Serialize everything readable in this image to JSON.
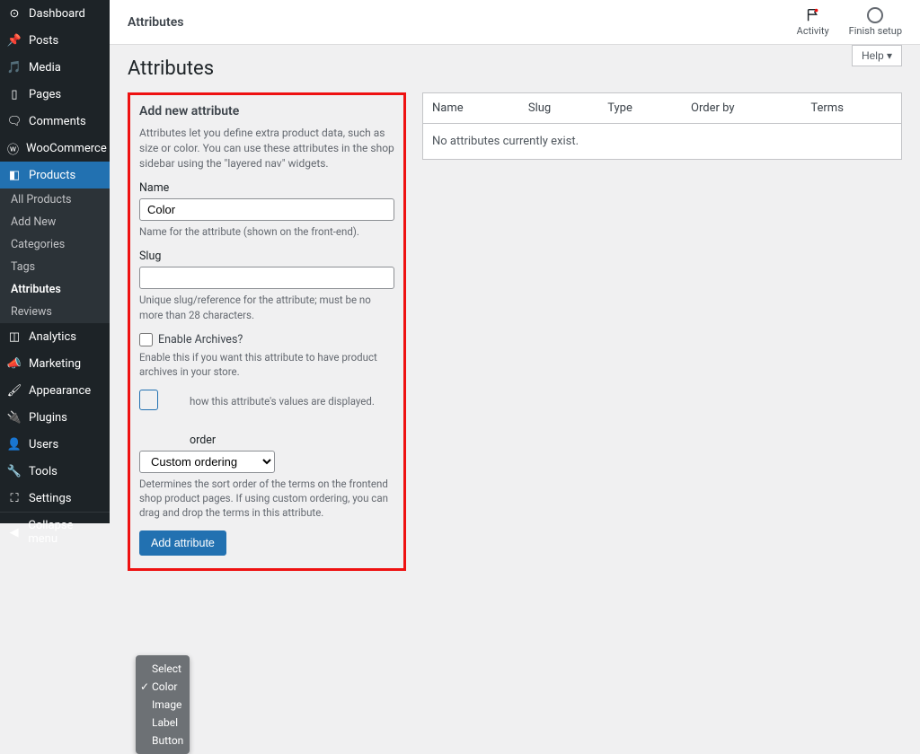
{
  "sidebar": {
    "items": [
      {
        "label": "Dashboard",
        "icon": "dashboard"
      },
      {
        "label": "Posts",
        "icon": "pin"
      },
      {
        "label": "Media",
        "icon": "media"
      },
      {
        "label": "Pages",
        "icon": "page"
      },
      {
        "label": "Comments",
        "icon": "comment"
      },
      {
        "label": "WooCommerce",
        "icon": "woo"
      },
      {
        "label": "Products",
        "icon": "products",
        "active": true
      },
      {
        "label": "Analytics",
        "icon": "analytics"
      },
      {
        "label": "Marketing",
        "icon": "marketing"
      },
      {
        "label": "Appearance",
        "icon": "appearance"
      },
      {
        "label": "Plugins",
        "icon": "plugins"
      },
      {
        "label": "Users",
        "icon": "users"
      },
      {
        "label": "Tools",
        "icon": "tools"
      },
      {
        "label": "Settings",
        "icon": "settings"
      }
    ],
    "products_submenu": [
      "All Products",
      "Add New",
      "Categories",
      "Tags",
      "Attributes",
      "Reviews"
    ],
    "collapse": "Collapse menu"
  },
  "topbar": {
    "title": "Attributes",
    "activity": "Activity",
    "finish": "Finish setup"
  },
  "page": {
    "heading": "Attributes",
    "help": "Help ▾"
  },
  "form": {
    "title": "Add new attribute",
    "intro": "Attributes let you define extra product data, such as size or color. You can use these attributes in the shop sidebar using the \"layered nav\" widgets.",
    "name_label": "Name",
    "name_value": "Color",
    "name_help": "Name for the attribute (shown on the front-end).",
    "slug_label": "Slug",
    "slug_value": "",
    "slug_help": "Unique slug/reference for the attribute; must be no more than 28 characters.",
    "archives_label": "Enable Archives?",
    "archives_help": "Enable this if you want this attribute to have product archives in your store.",
    "type_help_partial": "how this attribute's values are displayed.",
    "sort_label_partial": "order",
    "sort_value": "Custom ordering",
    "sort_help": "Determines the sort order of the terms on the frontend shop product pages. If using custom ordering, you can drag and drop the terms in this attribute.",
    "submit": "Add attribute"
  },
  "dropdown": {
    "options": [
      "Select",
      "Color",
      "Image",
      "Label",
      "Button"
    ],
    "selected": "Color"
  },
  "table": {
    "headers": [
      "Name",
      "Slug",
      "Type",
      "Order by",
      "Terms"
    ],
    "empty": "No attributes currently exist."
  }
}
